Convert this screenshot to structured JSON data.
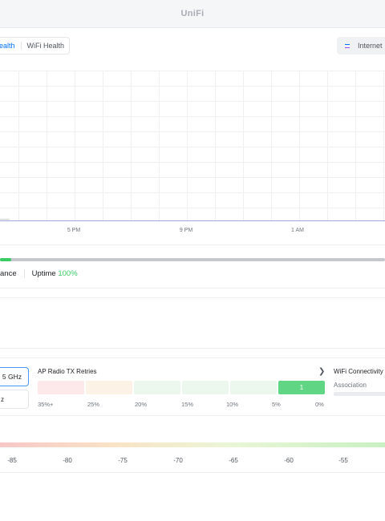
{
  "header": {
    "brand": "UniFi"
  },
  "tabs": {
    "active": "ealth",
    "other": "WiFi Health"
  },
  "internet_button": {
    "label": "Internet"
  },
  "chart": {
    "x_ticks": [
      "5 PM",
      "9 PM",
      "1 AM"
    ]
  },
  "status": {
    "progress": 0.03,
    "left_text": "ance",
    "uptime_label": "Uptime",
    "uptime_value": "100%"
  },
  "band": {
    "selected": "5 GHz",
    "other": "z"
  },
  "ap_radio": {
    "title": "AP Radio TX Retries",
    "cells": [
      {
        "label": "35%+",
        "color": "#fde9e9",
        "value": ""
      },
      {
        "label": "25%",
        "color": "#fdf2e6",
        "value": ""
      },
      {
        "label": "20%",
        "color": "#ecf8ee",
        "value": ""
      },
      {
        "label": "15%",
        "color": "#ecf8ee",
        "value": ""
      },
      {
        "label": "10%",
        "color": "#ecf8ee",
        "value": ""
      },
      {
        "label": "5%",
        "color": "#ecf8ee",
        "value": ""
      },
      {
        "label": "0%",
        "color": "#60d684",
        "value": "1"
      }
    ]
  },
  "wifi_connectivity": {
    "title": "WiFi Connectivity",
    "association": "Association"
  },
  "signal_scale": [
    "-85",
    "-80",
    "-75",
    "-70",
    "-65",
    "-60",
    "-55"
  ]
}
